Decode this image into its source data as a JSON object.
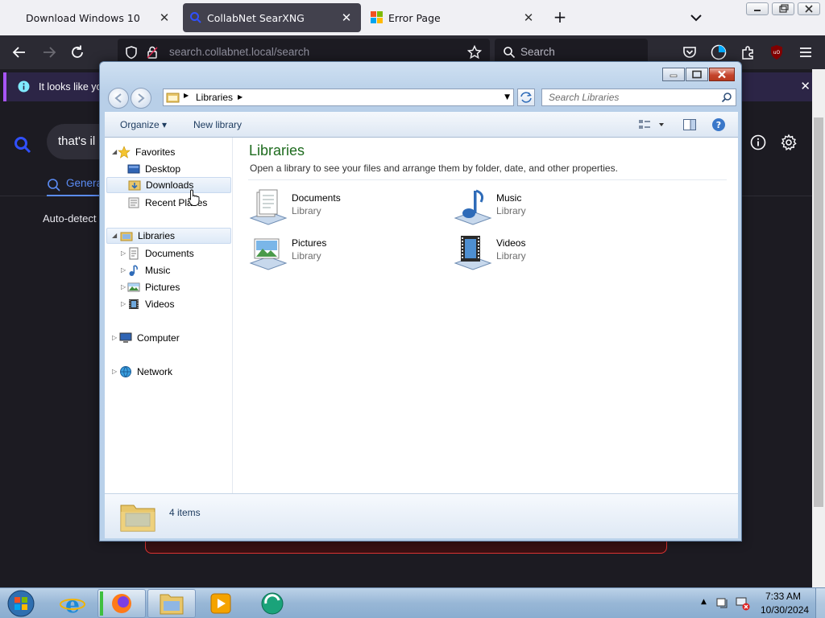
{
  "firefox": {
    "tabs": [
      {
        "title": "Download Windows 10"
      },
      {
        "title": "CollabNet SearXNG"
      },
      {
        "title": "Error Page"
      }
    ],
    "url": "search.collabnet.local/search",
    "search_placeholder": "Search"
  },
  "searx": {
    "notification": "It looks like you",
    "query": "that's il",
    "tab_general": "Genera",
    "autodetect": "Auto-detect"
  },
  "explorer": {
    "address_crumb": "Libraries",
    "search_placeholder": "Search Libraries",
    "toolbar": {
      "organize": "Organize",
      "new_library": "New library"
    },
    "nav": {
      "favorites": "Favorites",
      "favorites_items": [
        "Desktop",
        "Downloads",
        "Recent Places"
      ],
      "libraries": "Libraries",
      "libraries_items": [
        "Documents",
        "Music",
        "Pictures",
        "Videos"
      ],
      "computer": "Computer",
      "network": "Network"
    },
    "content": {
      "title": "Libraries",
      "description": "Open a library to see your files and arrange them by folder, date, and other properties.",
      "items": [
        {
          "name": "Documents",
          "type": "Library"
        },
        {
          "name": "Music",
          "type": "Library"
        },
        {
          "name": "Pictures",
          "type": "Library"
        },
        {
          "name": "Videos",
          "type": "Library"
        }
      ]
    },
    "status": "4 items"
  },
  "taskbar": {
    "time": "7:33 AM",
    "date": "10/30/2024"
  },
  "colors": {
    "title_green": "#1e6b1e",
    "firefox_dark": "#2b2a33",
    "selection": "#dde9f7"
  }
}
